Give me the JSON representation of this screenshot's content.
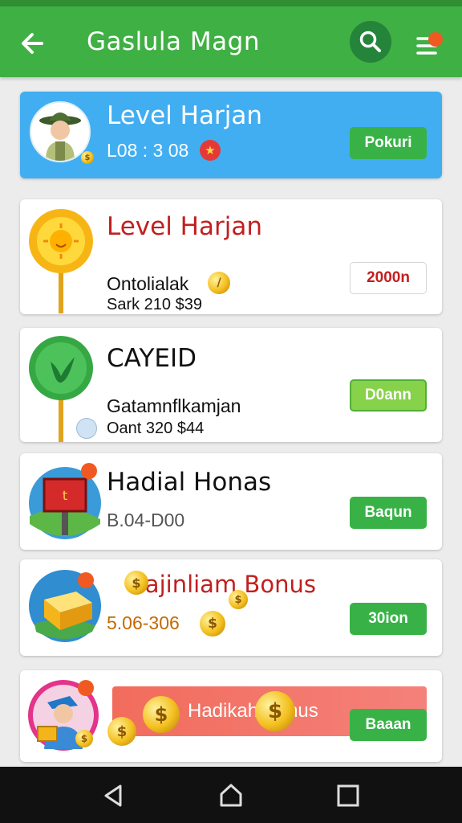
{
  "header": {
    "title": "Gaslula Magn",
    "icons": [
      "back-arrow-icon",
      "search-icon",
      "menu-icon"
    ]
  },
  "profile_card": {
    "title": "Level Harjan",
    "meta": "L08 : 3 08",
    "button": "Pokuri"
  },
  "cards": [
    {
      "title": "Level Harjan",
      "sub": "Ontolialak",
      "meta": "Sark 210 $39",
      "button": "2000n"
    },
    {
      "title": "CAYEID",
      "sub": "Gatamnflkamjan",
      "meta": "Oant 320 $44",
      "button": "D0ann"
    },
    {
      "title": "Hadial Honas",
      "sub": "B.04-D00",
      "button": "Baqun"
    },
    {
      "title": "Hajinliam Bonus",
      "sub": "5.06-306",
      "button": "30ion"
    },
    {
      "title": "Hadikah Bonus",
      "button": "Baaan"
    }
  ],
  "colors": {
    "appbar": "#3fb043",
    "accent_blue": "#41aef2",
    "button_green": "#38b247",
    "title_red": "#c21f1f"
  },
  "navbar": {
    "icons": [
      "back-triangle-icon",
      "home-icon",
      "recents-icon"
    ]
  }
}
